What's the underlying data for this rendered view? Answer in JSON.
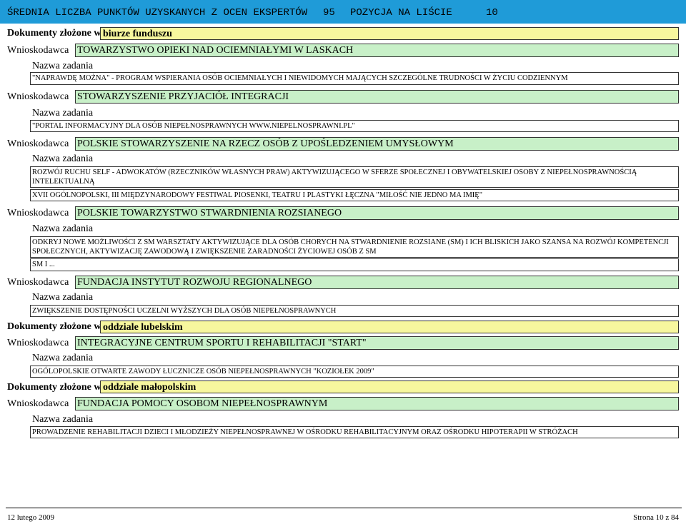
{
  "header": {
    "label": "ŚREDNIA LICZBA PUNKTÓW UZYSKANYCH Z OCEN EKSPERTÓW",
    "score": "95",
    "position_label": "POZYCJA NA LIŚCIE",
    "position": "10"
  },
  "labels": {
    "documents": "Dokumenty złożone w",
    "applicant": "Wnioskodawca",
    "task": "Nazwa zadania"
  },
  "sections": [
    {
      "office": "biurze funduszu"
    },
    {
      "applicant": "TOWARZYSTWO OPIEKI NAD OCIEMNIAŁYMI W LASKACH",
      "tasks": [
        "\"NAPRAWDĘ MOŻNA\" - PROGRAM WSPIERANIA OSÓB OCIEMNIAŁYCH I NIEWIDOMYCH MAJĄCYCH SZCZEGÓLNE TRUDNOŚCI W ŻYCIU CODZIENNYM"
      ]
    },
    {
      "applicant": "STOWARZYSZENIE PRZYJACIÓŁ INTEGRACJI",
      "tasks": [
        "\"PORTAL INFORMACYJNY DLA OSÓB NIEPEŁNOSPRAWNYCH WWW.NIEPELNOSPRAWNI.PL\""
      ]
    },
    {
      "applicant": "POLSKIE STOWARZYSZENIE NA RZECZ OSÓB Z UPOŚLEDZENIEM UMYSŁOWYM",
      "tasks": [
        "ROZWÓJ RUCHU SELF - ADWOKATÓW (RZECZNIKÓW WŁASNYCH PRAW) AKTYWIZUJĄCEGO W SFERZE SPOŁECZNEJ I OBYWATELSKIEJ OSOBY Z NIEPEŁNOSPRAWNOŚCIĄ INTELEKTUALNĄ",
        "XVII OGÓLNOPOLSKI, III MIĘDZYNARODOWY FESTIWAL PIOSENKI, TEATRU I PLASTYKI ŁĘCZNA \"MIŁOŚĆ NIE JEDNO MA IMIĘ\""
      ]
    },
    {
      "applicant": "POLSKIE TOWARZYSTWO STWARDNIENIA ROZSIANEGO",
      "tasks": [
        "ODKRYJ NOWE MOŻLIWOŚCI Z SM    WARSZTATY AKTYWIZUJĄCE DLA OSÓB CHORYCH NA STWARDNIENIE ROZSIANE (SM) I ICH BLISKICH JAKO SZANSA NA ROZWÓJ KOMPETENCJI SPOŁECZNYCH, AKTYWIZACJĘ ZAWODOWĄ I ZWIĘKSZENIE ZARADNOŚCI ŻYCIOWEJ OSÓB Z SM",
        "SM I ..."
      ]
    },
    {
      "applicant": "FUNDACJA INSTYTUT ROZWOJU REGIONALNEGO",
      "tasks": [
        "ZWIĘKSZENIE DOSTĘPNOŚCI UCZELNI WYŻSZYCH DLA OSÓB NIEPEŁNOSPRAWNYCH"
      ]
    },
    {
      "office": "oddziale lubelskim"
    },
    {
      "applicant": "INTEGRACYJNE CENTRUM SPORTU I REHABILITACJI \"START\"",
      "tasks": [
        "OGÓLOPOLSKIE OTWARTE ZAWODY ŁUCZNICZE OSÓB NIEPEŁNOSPRAWNYCH \"KOZIOŁEK 2009\""
      ]
    },
    {
      "office": "oddziale małopolskim"
    },
    {
      "applicant": "FUNDACJA POMOCY OSOBOM NIEPEŁNOSPRAWNYM",
      "tasks": [
        "PROWADZENIE REHABILITACJI DZIECI I MŁODZIEŻY NIEPEŁNOSPRAWNEJ W OŚRODKU REHABILITACYJNYM ORAZ OŚRODKU HIPOTERAPII W STRÓŻACH"
      ]
    }
  ],
  "footer": {
    "date": "12 lutego 2009",
    "page": "Strona 10 z 84"
  },
  "colors": {
    "header_bg": "#1f9bd8",
    "documents_bg": "#f7f79e",
    "applicant_bg": "#c8f0c8"
  }
}
